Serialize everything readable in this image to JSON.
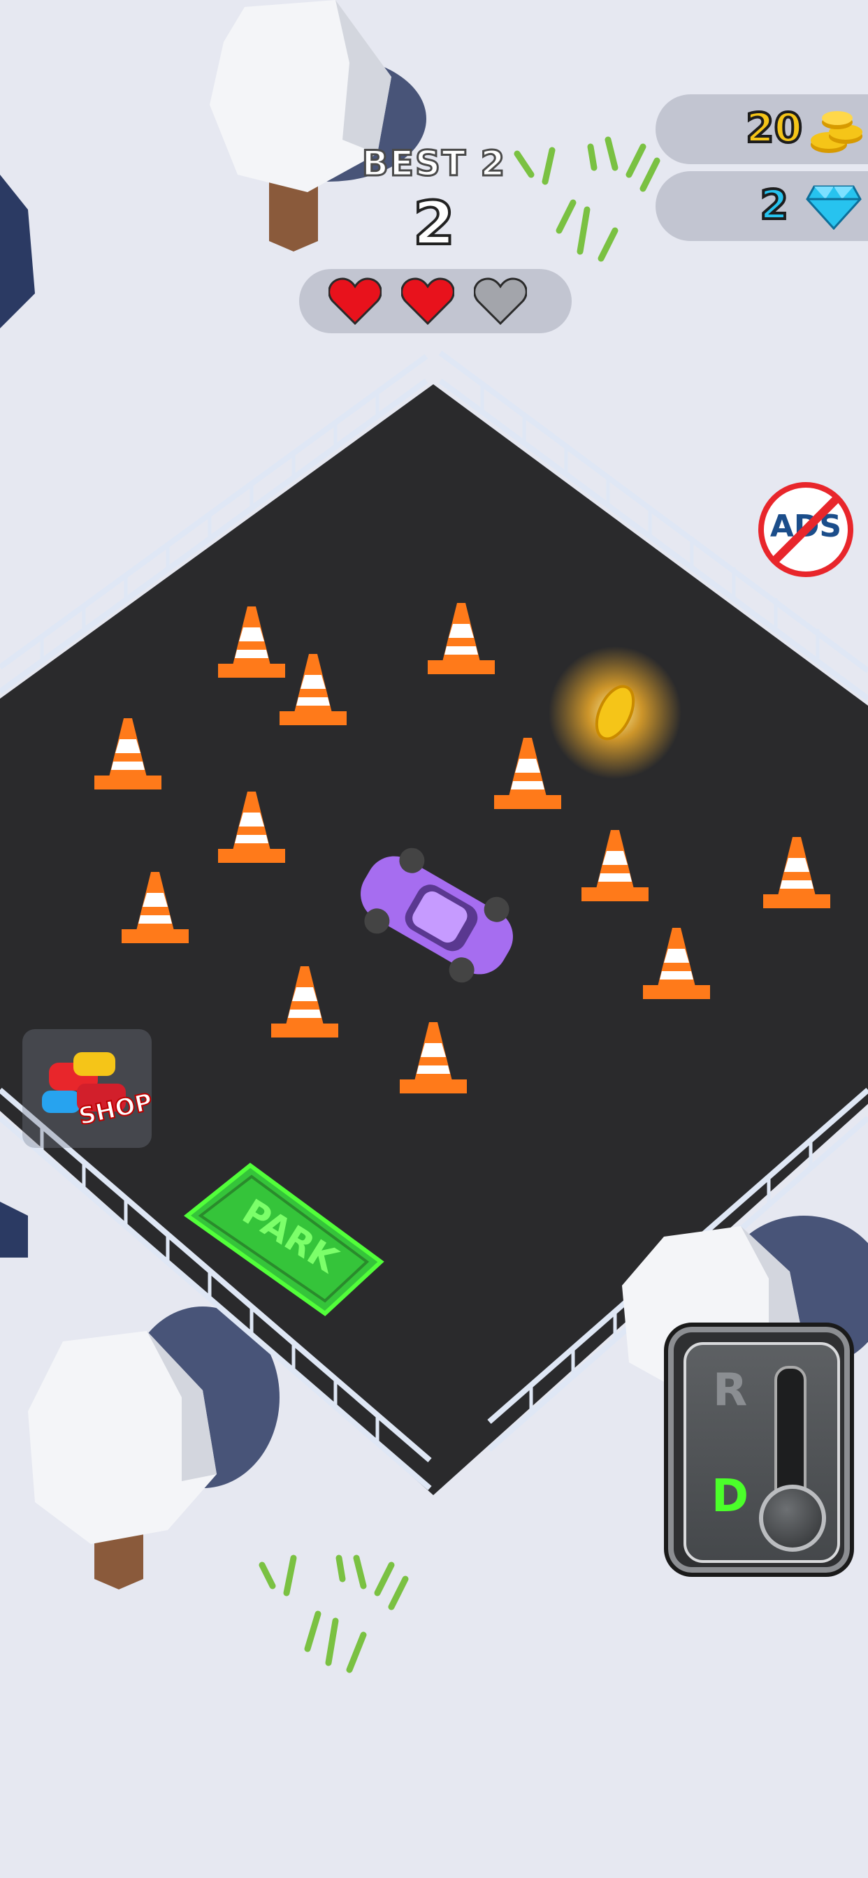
{
  "hud": {
    "best_label": "BEST 2",
    "score": "2",
    "lives_total": 3,
    "lives_remaining": 2
  },
  "currency": {
    "coins": "20",
    "gems": "2"
  },
  "buttons": {
    "no_ads_label": "ADS",
    "shop_label": "SHOP"
  },
  "parking": {
    "park_label": "PARK"
  },
  "gear_shifter": {
    "reverse_label": "R",
    "drive_label": "D",
    "selected": "D"
  },
  "colors": {
    "heart_active": "#e8121c",
    "heart_inactive": "#a3a5ab",
    "coin": "#f5c518",
    "gem": "#27c3ef",
    "drive_indicator": "#4bff2a",
    "park_zone": "#35c43a",
    "car": "#a66df0",
    "cone": "#ff7a1a"
  }
}
